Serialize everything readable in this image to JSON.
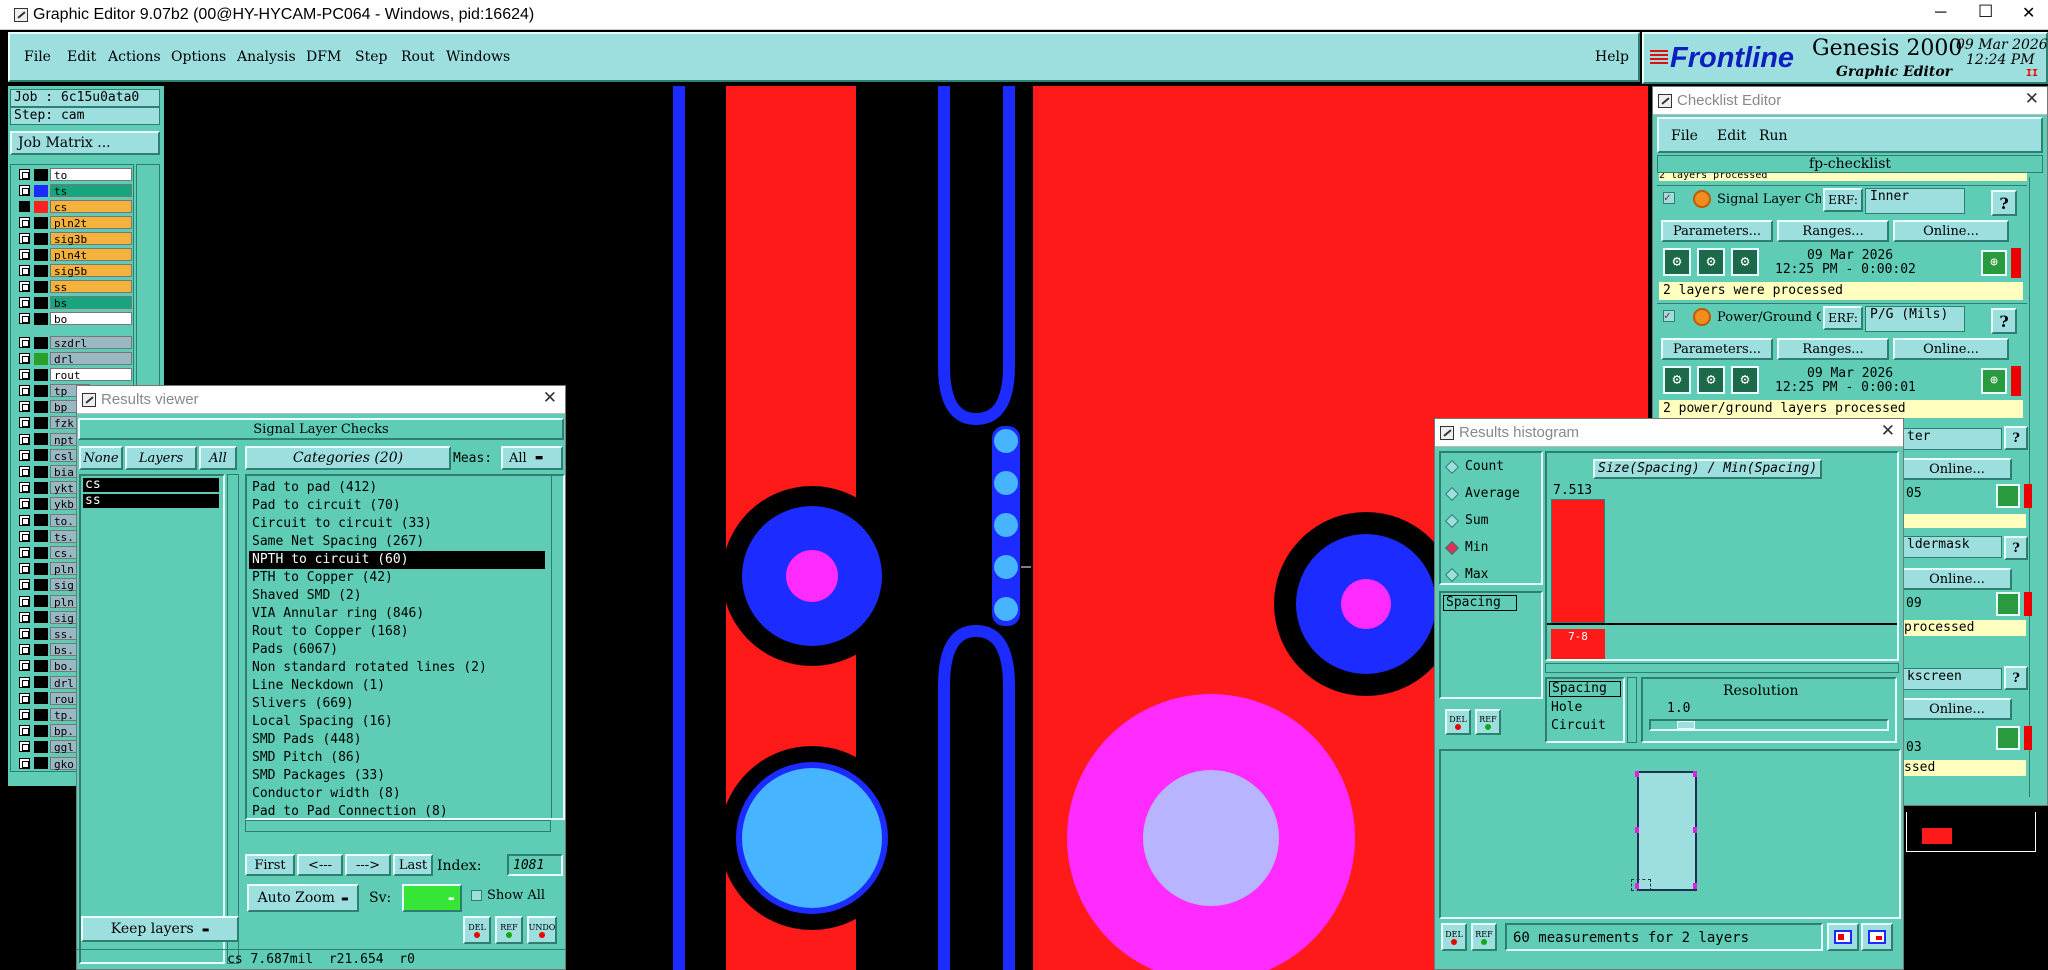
{
  "window": {
    "title": "Graphic Editor 9.07b2 (00@HY-HYCAM-PC064 - Windows, pid:16624)",
    "min": "─",
    "max": "☐",
    "close": "✕"
  },
  "menu": {
    "items": [
      "File",
      "Edit",
      "Actions",
      "Options",
      "Analysis",
      "DFM",
      "Step",
      "Rout",
      "Windows"
    ],
    "help": "Help"
  },
  "brand": {
    "logo": "Frontline",
    "product": "Genesis 2000",
    "subtitle": "Graphic Editor",
    "date": "09 Mar 2026",
    "time": "12:24 PM",
    "pause": "II"
  },
  "job": {
    "job": "Job : 6c15u0ata0",
    "step": "Step: cam",
    "matrix_button": "Job Matrix ..."
  },
  "layers": [
    {
      "name": "to",
      "color": "#ffffff",
      "swatch": "#000000",
      "active": false
    },
    {
      "name": "ts",
      "color": "#17a57e",
      "swatch": "#1c2bff",
      "active": false
    },
    {
      "name": "cs",
      "color": "#f4b13b",
      "swatch": "#ff2020",
      "active": true
    },
    {
      "name": "pln2t",
      "color": "#f4b13b",
      "swatch": "#000000",
      "active": false
    },
    {
      "name": "sig3b",
      "color": "#f4b13b",
      "swatch": "#000000",
      "active": false
    },
    {
      "name": "pln4t",
      "color": "#f4b13b",
      "swatch": "#000000",
      "active": false
    },
    {
      "name": "sig5b",
      "color": "#f4b13b",
      "swatch": "#000000",
      "active": false
    },
    {
      "name": "ss",
      "color": "#f4b13b",
      "swatch": "#000000",
      "active": false
    },
    {
      "name": "bs",
      "color": "#17a57e",
      "swatch": "#000000",
      "active": false
    },
    {
      "name": "bo",
      "color": "#ffffff",
      "swatch": "#000000",
      "active": false
    }
  ],
  "layers2": [
    {
      "name": "szdrl",
      "color": "#9ab7c4",
      "swatch": "#000000"
    },
    {
      "name": "drl",
      "color": "#9ab7c4",
      "swatch": "#2aa02a"
    },
    {
      "name": "rout",
      "color": "#ffffff",
      "swatch": "#000000"
    }
  ],
  "layers3": [
    "tp",
    "bp",
    "fzk",
    "npt",
    "csl",
    "bia",
    "ykt",
    "ykb",
    "to.",
    "ts.",
    "cs.",
    "pln",
    "sig",
    "pln",
    "sig",
    "ss.",
    "bs.",
    "bo.",
    "drl",
    "rou",
    "tp.",
    "bp.",
    "ggl",
    "gko"
  ],
  "results_viewer": {
    "title": "Results viewer",
    "header": "Signal Layer Checks",
    "none": "None",
    "layers": "Layers",
    "all": "All",
    "layer_list": [
      "cs",
      "ss"
    ],
    "categories_button": "Categories (20)",
    "meas_label": "Meas:",
    "meas_value": "All",
    "categories": [
      "Pad to pad (412)",
      "Pad to circuit (70)",
      "Circuit to circuit (33)",
      "Same Net Spacing (267)",
      "NPTH to circuit (60)",
      "PTH to Copper (42)",
      "Shaved SMD (2)",
      "VIA Annular ring (846)",
      "Rout to Copper (168)",
      "Pads (6067)",
      "Non standard rotated lines (2)",
      "Line Neckdown (1)",
      "Slivers (669)",
      "Local Spacing (16)",
      "SMD Pads (448)",
      "SMD Pitch (86)",
      "SMD Packages (33)",
      "Conductor width (8)",
      "Pad to Pad Connection (8)"
    ],
    "selected_index": 4,
    "first": "First",
    "prev": "<---",
    "next": "--->",
    "last": "Last",
    "index_label": "Index:",
    "index_value": "1081",
    "auto_zoom": "Auto Zoom",
    "sv_label": "Sv:",
    "show_all": "Show All",
    "keep_layers": "Keep layers",
    "del": "DEL",
    "ref": "REF",
    "undo": "UNDO",
    "status": "cs 7.687mil  r21.654  r0"
  },
  "checklist": {
    "title": "Checklist Editor",
    "menu": [
      "File",
      "Edit",
      "Run"
    ],
    "name": "fp-checklist",
    "top_text": "2 layers processed",
    "items": [
      {
        "name": "Signal Layer Ch",
        "erf_label": "ERF:",
        "erf": "Inner",
        "params": "Parameters...",
        "ranges": "Ranges...",
        "online": "Online...",
        "date": "09 Mar 2026",
        "time": "12:25 PM - 0:00:02",
        "result": "2 layers were processed"
      },
      {
        "name": "Power/Ground C",
        "erf_label": "ERF:",
        "erf": "P/G (Mils)",
        "params": "Parameters...",
        "ranges": "Ranges...",
        "online": "Online...",
        "date": "09 Mar 2026",
        "time": "12:25 PM - 0:00:01",
        "result": "2 power/ground layers processed"
      }
    ],
    "partial": [
      "ter",
      "Online...",
      "05",
      "ldermask",
      "Online...",
      "09",
      "processed",
      "kscreen",
      "Online...",
      "03",
      "ssed"
    ],
    "help": "?"
  },
  "histogram": {
    "title": "Results histogram",
    "radios": [
      "Count",
      "Average",
      "Sum",
      "Min",
      "Max"
    ],
    "selected_radio": "Min",
    "list": [
      "Spacing"
    ],
    "chart_title": "Size(Spacing) / Min(Spacing)",
    "bar_value": "7.513",
    "bar_label": "7-8",
    "options": [
      "Spacing",
      "Hole",
      "Circuit"
    ],
    "resolution_label": "Resolution",
    "resolution_value": "1.0",
    "status": "60 measurements for 2 layers",
    "del": "DEL",
    "ref": "REF"
  },
  "colors": {
    "teal": "#5fcdb5",
    "light_teal": "#9ddede",
    "copper": "#ff1a1a",
    "trace": "#1c2bff",
    "pad": "#47b4ff",
    "drill": "#ff2bff"
  }
}
